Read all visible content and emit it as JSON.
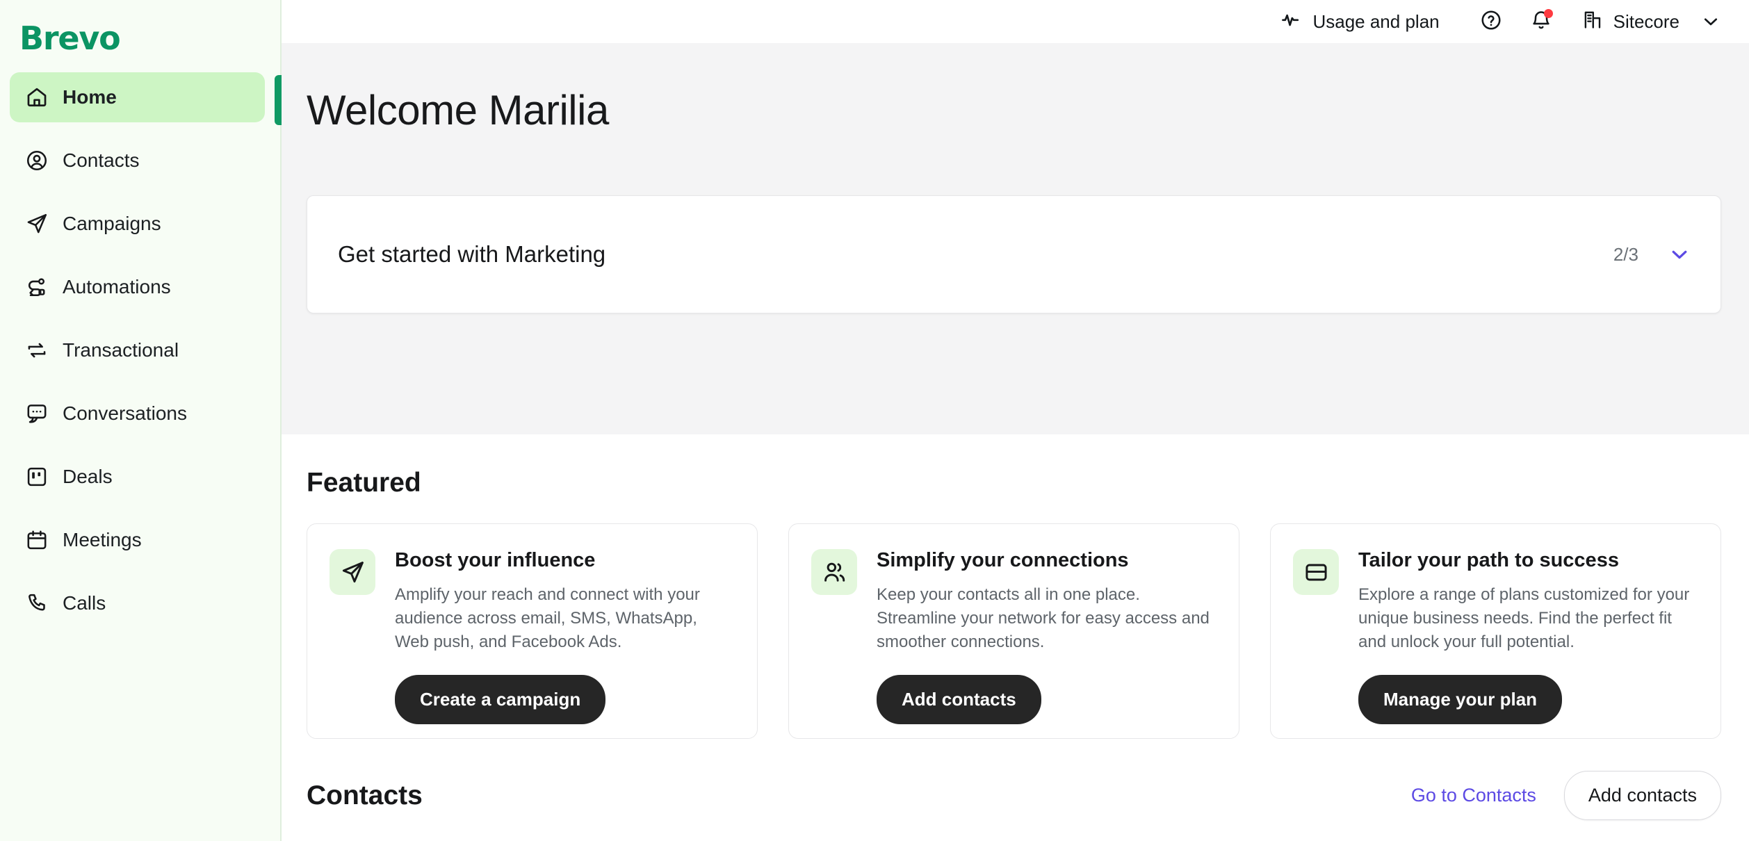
{
  "brand": {
    "name": "Brevo",
    "color": "#0b9463"
  },
  "sidebar": {
    "items": [
      {
        "label": "Home",
        "icon": "home-icon",
        "active": true
      },
      {
        "label": "Contacts",
        "icon": "contacts-icon",
        "active": false
      },
      {
        "label": "Campaigns",
        "icon": "campaigns-icon",
        "active": false
      },
      {
        "label": "Automations",
        "icon": "automations-icon",
        "active": false
      },
      {
        "label": "Transactional",
        "icon": "transactional-icon",
        "active": false
      },
      {
        "label": "Conversations",
        "icon": "conversations-icon",
        "active": false
      },
      {
        "label": "Deals",
        "icon": "deals-icon",
        "active": false
      },
      {
        "label": "Meetings",
        "icon": "meetings-icon",
        "active": false
      },
      {
        "label": "Calls",
        "icon": "calls-icon",
        "active": false
      }
    ],
    "active_indicator_color": "#109a64",
    "active_item_background": "#cdf5c4"
  },
  "topbar": {
    "usage_label": "Usage and plan",
    "usage_icon": "activity-pulse-icon",
    "help_icon": "help-circle-icon",
    "notifications_icon": "bell-icon",
    "notification_dot_color": "#ff3b41",
    "account_icon": "building-icon",
    "account_name": "Sitecore",
    "account_chevron": "chevron-down-icon"
  },
  "hero": {
    "welcome_title": "Welcome Marilia",
    "get_started": {
      "title": "Get started with Marketing",
      "progress": "2/3",
      "chevron": "chevron-down-icon",
      "chevron_color": "#5c4ae4"
    }
  },
  "featured": {
    "title": "Featured",
    "cards": [
      {
        "icon": "paper-plane-icon",
        "title": "Boost your influence",
        "description": "Amplify your reach and connect with your audience across email, SMS, WhatsApp, Web push, and Facebook Ads.",
        "button": "Create a campaign"
      },
      {
        "icon": "users-icon",
        "title": "Simplify your connections",
        "description": "Keep your contacts all in one place. Streamline your network for easy access and smoother connections.",
        "button": "Add contacts"
      },
      {
        "icon": "credit-card-icon",
        "title": "Tailor your path to success",
        "description": "Explore a range of plans customized for your unique business needs. Find the perfect fit and unlock your full potential.",
        "button": "Manage your plan"
      }
    ]
  },
  "contacts_section": {
    "title": "Contacts",
    "link_label": "Go to Contacts",
    "link_color": "#5c4ae4",
    "button_label": "Add contacts"
  }
}
